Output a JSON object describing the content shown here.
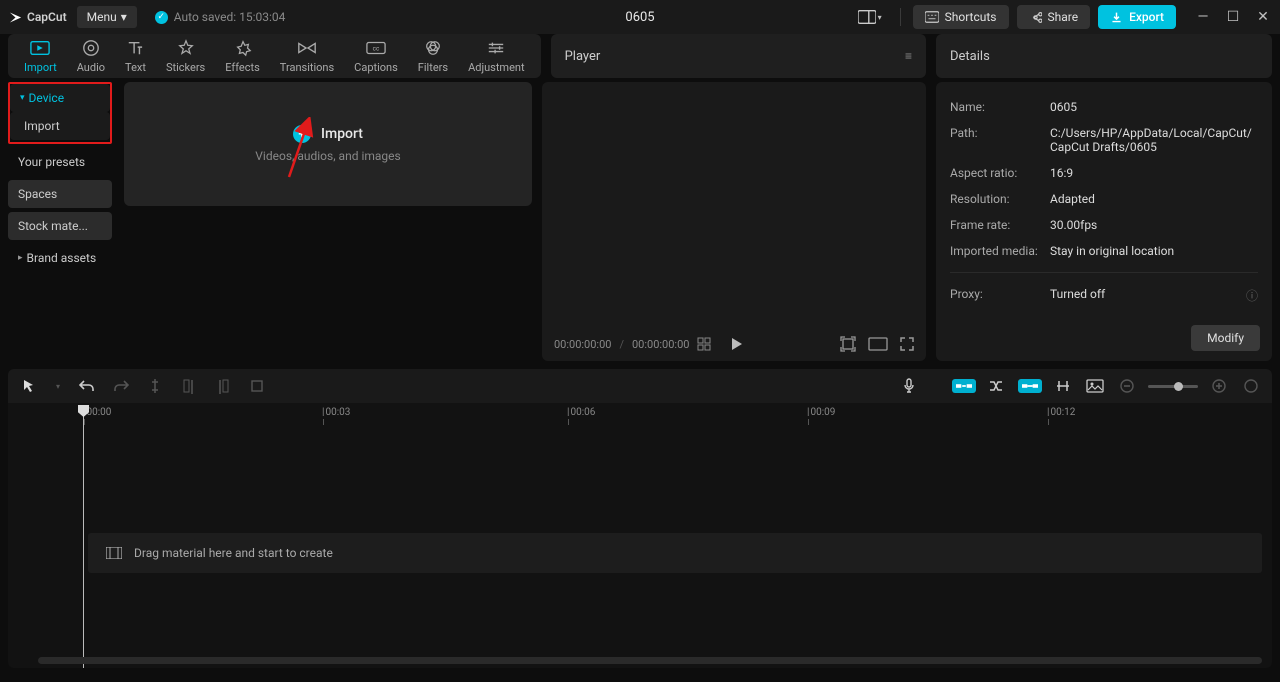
{
  "titlebar": {
    "app_name": "CapCut",
    "menu_label": "Menu",
    "autosave": "Auto saved: 15:03:04",
    "project": "0605",
    "shortcuts": "Shortcuts",
    "share": "Share",
    "export": "Export"
  },
  "tooltabs": [
    "Import",
    "Audio",
    "Text",
    "Stickers",
    "Effects",
    "Transitions",
    "Captions",
    "Filters",
    "Adjustment"
  ],
  "panels": {
    "player": "Player",
    "details": "Details"
  },
  "sidebar": {
    "device": "Device",
    "import": "Import",
    "presets": "Your presets",
    "spaces": "Spaces",
    "stock": "Stock mate...",
    "brand": "Brand assets"
  },
  "import_zone": {
    "title": "Import",
    "subtitle": "Videos, audios, and images"
  },
  "player_controls": {
    "current": "00:00:00:00",
    "total": "00:00:00:00"
  },
  "details": {
    "name_label": "Name:",
    "name_val": "0605",
    "path_label": "Path:",
    "path_val": "C:/Users/HP/AppData/Local/CapCut/CapCut Drafts/0605",
    "aspect_label": "Aspect ratio:",
    "aspect_val": "16:9",
    "res_label": "Resolution:",
    "res_val": "Adapted",
    "fps_label": "Frame rate:",
    "fps_val": "30.00fps",
    "media_label": "Imported media:",
    "media_val": "Stay in original location",
    "proxy_label": "Proxy:",
    "proxy_val": "Turned off",
    "modify": "Modify"
  },
  "timeline": {
    "ticks": [
      {
        "pos": 76,
        "label": "00:00"
      },
      {
        "pos": 315,
        "label": "00:03"
      },
      {
        "pos": 560,
        "label": "00:06"
      },
      {
        "pos": 800,
        "label": "00:09"
      },
      {
        "pos": 1040,
        "label": "00:12"
      }
    ],
    "drop_hint": "Drag material here and start to create"
  }
}
